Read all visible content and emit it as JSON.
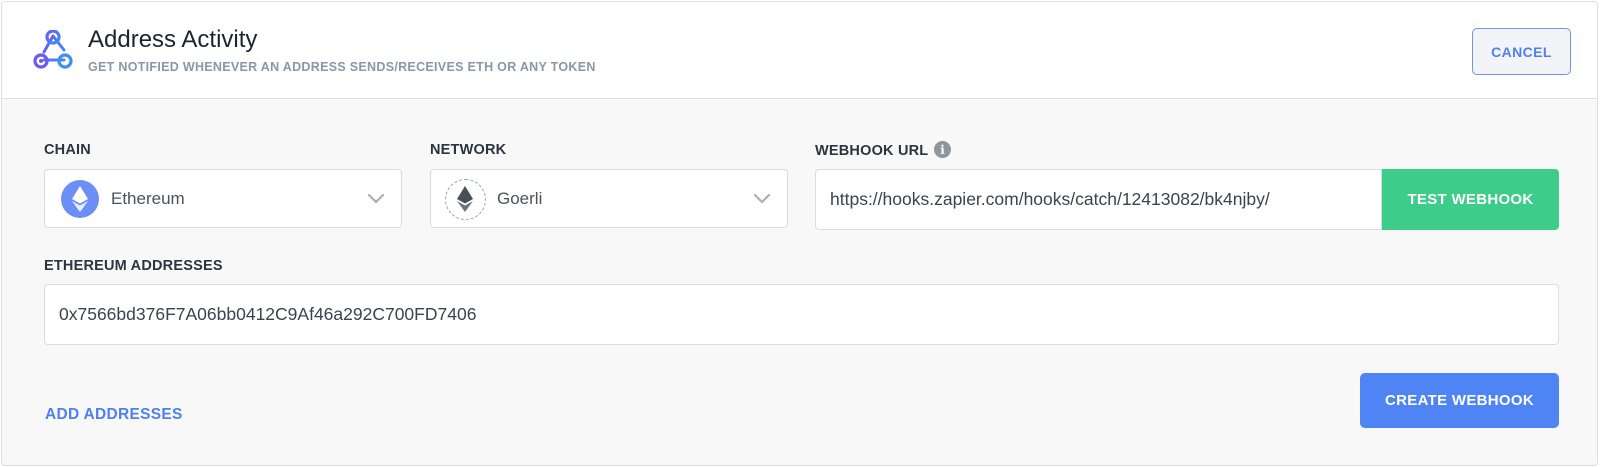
{
  "header": {
    "icon": "webhook-icon",
    "title": "Address Activity",
    "subtitle": "GET NOTIFIED WHENEVER AN ADDRESS SENDS/RECEIVES ETH OR ANY TOKEN",
    "cancel_label": "CANCEL"
  },
  "form": {
    "chain": {
      "label": "CHAIN",
      "value": "Ethereum",
      "icon": "ethereum-icon"
    },
    "network": {
      "label": "NETWORK",
      "value": "Goerli",
      "icon": "ethereum-icon"
    },
    "webhook": {
      "label": "WEBHOOK URL",
      "info_icon": "info-icon",
      "info_glyph": "i",
      "url": "https://hooks.zapier.com/hooks/catch/12413082/bk4njby/",
      "test_label": "TEST WEBHOOK"
    },
    "addresses": {
      "label": "ETHEREUM ADDRESSES",
      "value": "0x7566bd376F7A06bb0412C9Af46a292C700FD7406"
    },
    "add_addresses_label": "ADD ADDRESSES",
    "create_label": "CREATE WEBHOOK"
  },
  "colors": {
    "accent_blue": "#4f84f5",
    "test_green": "#3dcc8a",
    "ethereum_purple": "#6c8ff7"
  }
}
